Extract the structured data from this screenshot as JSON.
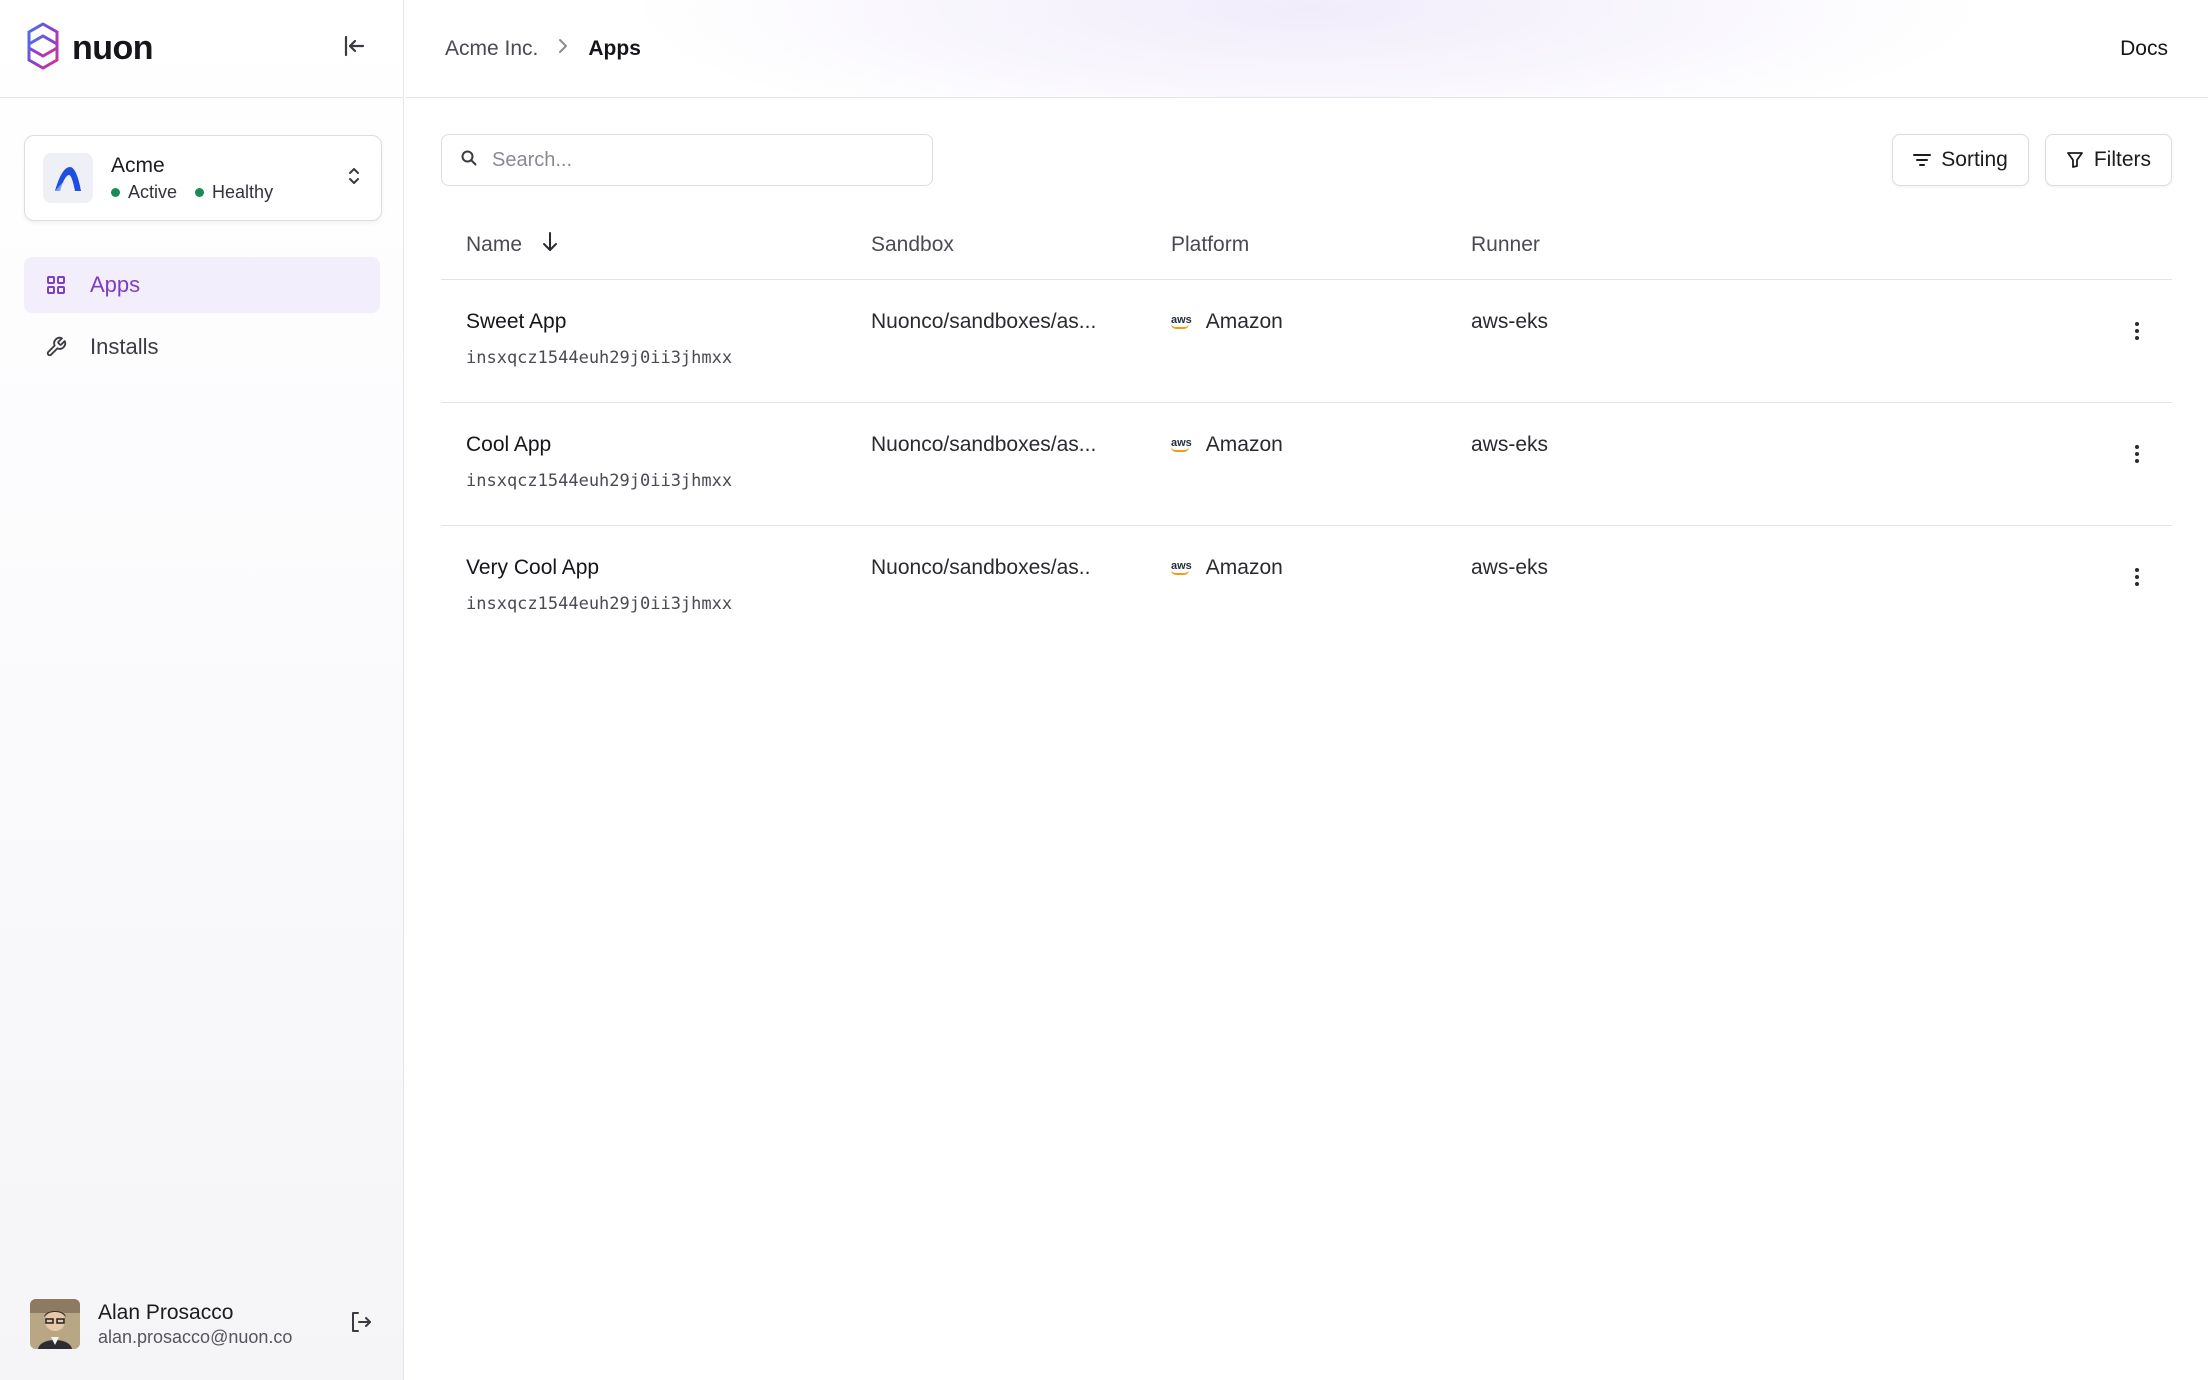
{
  "sidebar": {
    "logo_text": "nuon",
    "org": {
      "name": "Acme",
      "status_active": "Active",
      "status_health": "Healthy"
    },
    "nav": [
      {
        "label": "Apps",
        "icon": "grid-icon",
        "active": true
      },
      {
        "label": "Installs",
        "icon": "wrench-icon",
        "active": false
      }
    ],
    "user": {
      "name": "Alan Prosacco",
      "email": "alan.prosacco@nuon.co"
    }
  },
  "header": {
    "breadcrumb": {
      "parent": "Acme Inc.",
      "current": "Apps"
    },
    "docs_label": "Docs"
  },
  "toolbar": {
    "search_placeholder": "Search...",
    "sorting_label": "Sorting",
    "filters_label": "Filters"
  },
  "table": {
    "columns": {
      "name": "Name",
      "sandbox": "Sandbox",
      "platform": "Platform",
      "runner": "Runner"
    },
    "rows": [
      {
        "name": "Sweet App",
        "id": "insxqcz1544euh29j0ii3jhmxx",
        "sandbox": "Nuonco/sandboxes/as...",
        "platform": "Amazon",
        "runner": "aws-eks"
      },
      {
        "name": "Cool App",
        "id": "insxqcz1544euh29j0ii3jhmxx",
        "sandbox": "Nuonco/sandboxes/as...",
        "platform": "Amazon",
        "runner": "aws-eks"
      },
      {
        "name": "Very Cool App",
        "id": "insxqcz1544euh29j0ii3jhmxx",
        "sandbox": "Nuonco/sandboxes/as..",
        "platform": "Amazon",
        "runner": "aws-eks"
      }
    ]
  },
  "colors": {
    "accent": "#7b3fc4",
    "active_bg": "#f3eefc",
    "status_green": "#1b8a5a",
    "aws_orange": "#f39c12"
  }
}
